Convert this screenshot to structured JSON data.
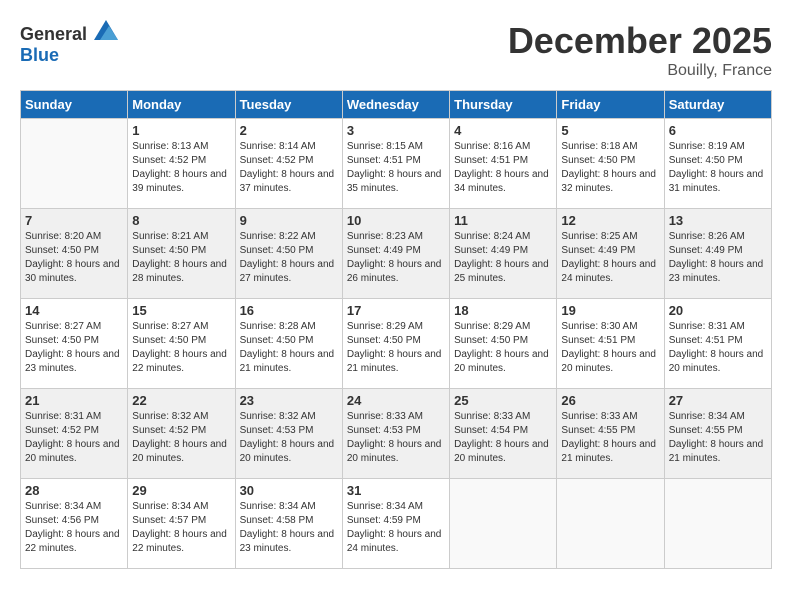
{
  "header": {
    "logo_general": "General",
    "logo_blue": "Blue",
    "month_year": "December 2025",
    "location": "Bouilly, France"
  },
  "days_of_week": [
    "Sunday",
    "Monday",
    "Tuesday",
    "Wednesday",
    "Thursday",
    "Friday",
    "Saturday"
  ],
  "weeks": [
    [
      {
        "day": "",
        "sunrise": "",
        "sunset": "",
        "daylight": ""
      },
      {
        "day": "1",
        "sunrise": "Sunrise: 8:13 AM",
        "sunset": "Sunset: 4:52 PM",
        "daylight": "Daylight: 8 hours and 39 minutes."
      },
      {
        "day": "2",
        "sunrise": "Sunrise: 8:14 AM",
        "sunset": "Sunset: 4:52 PM",
        "daylight": "Daylight: 8 hours and 37 minutes."
      },
      {
        "day": "3",
        "sunrise": "Sunrise: 8:15 AM",
        "sunset": "Sunset: 4:51 PM",
        "daylight": "Daylight: 8 hours and 35 minutes."
      },
      {
        "day": "4",
        "sunrise": "Sunrise: 8:16 AM",
        "sunset": "Sunset: 4:51 PM",
        "daylight": "Daylight: 8 hours and 34 minutes."
      },
      {
        "day": "5",
        "sunrise": "Sunrise: 8:18 AM",
        "sunset": "Sunset: 4:50 PM",
        "daylight": "Daylight: 8 hours and 32 minutes."
      },
      {
        "day": "6",
        "sunrise": "Sunrise: 8:19 AM",
        "sunset": "Sunset: 4:50 PM",
        "daylight": "Daylight: 8 hours and 31 minutes."
      }
    ],
    [
      {
        "day": "7",
        "sunrise": "Sunrise: 8:20 AM",
        "sunset": "Sunset: 4:50 PM",
        "daylight": "Daylight: 8 hours and 30 minutes."
      },
      {
        "day": "8",
        "sunrise": "Sunrise: 8:21 AM",
        "sunset": "Sunset: 4:50 PM",
        "daylight": "Daylight: 8 hours and 28 minutes."
      },
      {
        "day": "9",
        "sunrise": "Sunrise: 8:22 AM",
        "sunset": "Sunset: 4:50 PM",
        "daylight": "Daylight: 8 hours and 27 minutes."
      },
      {
        "day": "10",
        "sunrise": "Sunrise: 8:23 AM",
        "sunset": "Sunset: 4:49 PM",
        "daylight": "Daylight: 8 hours and 26 minutes."
      },
      {
        "day": "11",
        "sunrise": "Sunrise: 8:24 AM",
        "sunset": "Sunset: 4:49 PM",
        "daylight": "Daylight: 8 hours and 25 minutes."
      },
      {
        "day": "12",
        "sunrise": "Sunrise: 8:25 AM",
        "sunset": "Sunset: 4:49 PM",
        "daylight": "Daylight: 8 hours and 24 minutes."
      },
      {
        "day": "13",
        "sunrise": "Sunrise: 8:26 AM",
        "sunset": "Sunset: 4:49 PM",
        "daylight": "Daylight: 8 hours and 23 minutes."
      }
    ],
    [
      {
        "day": "14",
        "sunrise": "Sunrise: 8:27 AM",
        "sunset": "Sunset: 4:50 PM",
        "daylight": "Daylight: 8 hours and 23 minutes."
      },
      {
        "day": "15",
        "sunrise": "Sunrise: 8:27 AM",
        "sunset": "Sunset: 4:50 PM",
        "daylight": "Daylight: 8 hours and 22 minutes."
      },
      {
        "day": "16",
        "sunrise": "Sunrise: 8:28 AM",
        "sunset": "Sunset: 4:50 PM",
        "daylight": "Daylight: 8 hours and 21 minutes."
      },
      {
        "day": "17",
        "sunrise": "Sunrise: 8:29 AM",
        "sunset": "Sunset: 4:50 PM",
        "daylight": "Daylight: 8 hours and 21 minutes."
      },
      {
        "day": "18",
        "sunrise": "Sunrise: 8:29 AM",
        "sunset": "Sunset: 4:50 PM",
        "daylight": "Daylight: 8 hours and 20 minutes."
      },
      {
        "day": "19",
        "sunrise": "Sunrise: 8:30 AM",
        "sunset": "Sunset: 4:51 PM",
        "daylight": "Daylight: 8 hours and 20 minutes."
      },
      {
        "day": "20",
        "sunrise": "Sunrise: 8:31 AM",
        "sunset": "Sunset: 4:51 PM",
        "daylight": "Daylight: 8 hours and 20 minutes."
      }
    ],
    [
      {
        "day": "21",
        "sunrise": "Sunrise: 8:31 AM",
        "sunset": "Sunset: 4:52 PM",
        "daylight": "Daylight: 8 hours and 20 minutes."
      },
      {
        "day": "22",
        "sunrise": "Sunrise: 8:32 AM",
        "sunset": "Sunset: 4:52 PM",
        "daylight": "Daylight: 8 hours and 20 minutes."
      },
      {
        "day": "23",
        "sunrise": "Sunrise: 8:32 AM",
        "sunset": "Sunset: 4:53 PM",
        "daylight": "Daylight: 8 hours and 20 minutes."
      },
      {
        "day": "24",
        "sunrise": "Sunrise: 8:33 AM",
        "sunset": "Sunset: 4:53 PM",
        "daylight": "Daylight: 8 hours and 20 minutes."
      },
      {
        "day": "25",
        "sunrise": "Sunrise: 8:33 AM",
        "sunset": "Sunset: 4:54 PM",
        "daylight": "Daylight: 8 hours and 20 minutes."
      },
      {
        "day": "26",
        "sunrise": "Sunrise: 8:33 AM",
        "sunset": "Sunset: 4:55 PM",
        "daylight": "Daylight: 8 hours and 21 minutes."
      },
      {
        "day": "27",
        "sunrise": "Sunrise: 8:34 AM",
        "sunset": "Sunset: 4:55 PM",
        "daylight": "Daylight: 8 hours and 21 minutes."
      }
    ],
    [
      {
        "day": "28",
        "sunrise": "Sunrise: 8:34 AM",
        "sunset": "Sunset: 4:56 PM",
        "daylight": "Daylight: 8 hours and 22 minutes."
      },
      {
        "day": "29",
        "sunrise": "Sunrise: 8:34 AM",
        "sunset": "Sunset: 4:57 PM",
        "daylight": "Daylight: 8 hours and 22 minutes."
      },
      {
        "day": "30",
        "sunrise": "Sunrise: 8:34 AM",
        "sunset": "Sunset: 4:58 PM",
        "daylight": "Daylight: 8 hours and 23 minutes."
      },
      {
        "day": "31",
        "sunrise": "Sunrise: 8:34 AM",
        "sunset": "Sunset: 4:59 PM",
        "daylight": "Daylight: 8 hours and 24 minutes."
      },
      {
        "day": "",
        "sunrise": "",
        "sunset": "",
        "daylight": ""
      },
      {
        "day": "",
        "sunrise": "",
        "sunset": "",
        "daylight": ""
      },
      {
        "day": "",
        "sunrise": "",
        "sunset": "",
        "daylight": ""
      }
    ]
  ]
}
